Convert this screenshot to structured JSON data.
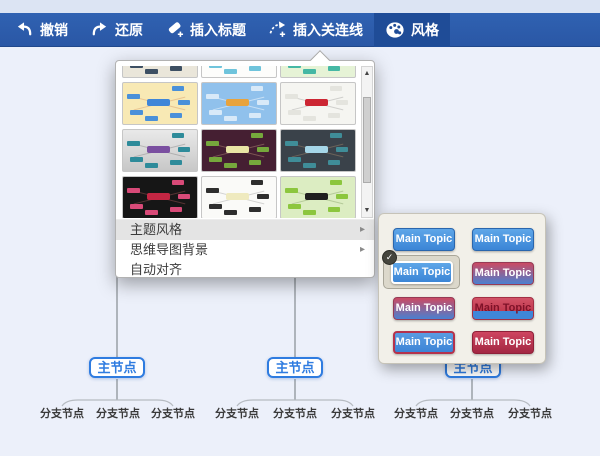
{
  "toolbar": {
    "items": [
      {
        "label": "撤销",
        "icon": "undo-icon",
        "active": false
      },
      {
        "label": "还原",
        "icon": "redo-icon",
        "active": false
      },
      {
        "label": "插入标题",
        "icon": "insert-title-icon",
        "active": false
      },
      {
        "label": "插入关连线",
        "icon": "insert-connector-icon",
        "active": false
      },
      {
        "label": "风格",
        "icon": "palette-icon",
        "active": true
      }
    ]
  },
  "style_panel": {
    "menu_items": [
      {
        "label": "主题风格",
        "has_submenu": true,
        "highlighted": true
      },
      {
        "label": "思维导图背景",
        "has_submenu": true,
        "highlighted": false
      },
      {
        "label": "自动对齐",
        "has_submenu": false,
        "highlighted": false
      }
    ],
    "submenu_caret": "▸",
    "scrollbar": {
      "up": "▲",
      "down": "▼"
    },
    "themes": [
      {
        "bg": "#eae6da",
        "center": "#3d4f63",
        "node": "#3d4f63",
        "line": "rgba(120,110,90,0.4)"
      },
      {
        "bg": "#fdfdfb",
        "center": "#4a90d9",
        "node": "#6fc4dc",
        "line": "rgba(150,150,150,0.35)"
      },
      {
        "bg": "#e6f3d6",
        "center": "#45b8a4",
        "node": "#45b8a4",
        "line": "rgba(120,150,100,0.4)"
      },
      {
        "bg": "#f8e9b4",
        "center": "#3f86d8",
        "node": "#4a90d9",
        "line": "rgba(215,150,100,0.45)"
      },
      {
        "bg": "#90c1ec",
        "center": "#e8a33d",
        "node": "#d8e9f8",
        "line": "rgba(255,255,255,0.5)"
      },
      {
        "bg": "#f5f5f1",
        "center": "#cc2633",
        "node": "#e4e4de",
        "line": "rgba(150,150,150,0.4)"
      },
      {
        "bg": "linear-gradient(#e9e9e9,#c7c7c7)",
        "center": "#7a4fa0",
        "node": "#2e8b9a",
        "line": "rgba(120,120,120,0.4)"
      },
      {
        "bg": "#451f32",
        "center": "#e9e5a5",
        "node": "#76a83c",
        "line": "rgba(230,190,150,0.35)"
      },
      {
        "bg": "#3a424a",
        "center": "#a5d6e8",
        "node": "#3f8d98",
        "line": "rgba(200,160,120,0.35)"
      },
      {
        "bg": "#161616",
        "center": "#c32643",
        "node": "#d84a78",
        "line": "rgba(240,120,120,0.3)"
      },
      {
        "bg": "#fafaf8",
        "center": "#efeabf",
        "node": "#2e2e2e",
        "line": "rgba(150,150,150,0.4)"
      },
      {
        "bg": "#dcedc2",
        "center": "#1f1f1f",
        "node": "#8cc63e",
        "line": "rgba(120,150,90,0.4)"
      }
    ]
  },
  "submenu": {
    "checkmark": "✓",
    "buttons": [
      {
        "label": "Main Topic",
        "style": "flat",
        "selected": false
      },
      {
        "label": "Main Topic",
        "style": "flat",
        "selected": false
      },
      {
        "label": "Main Topic",
        "style": "sel",
        "selected": true
      },
      {
        "label": "Main Topic",
        "style": "grad",
        "selected": false
      },
      {
        "label": "Main Topic",
        "style": "grad",
        "selected": false
      },
      {
        "label": "Main Topic",
        "style": "split",
        "selected": false
      },
      {
        "label": "Main Topic",
        "style": "rim",
        "selected": false
      },
      {
        "label": "Main Topic",
        "style": "crim",
        "selected": false
      }
    ]
  },
  "mindmap": {
    "nodes": [
      {
        "label": "主节点",
        "children": [
          "分支节点",
          "分支节点",
          "分支节点"
        ]
      },
      {
        "label": "主节点",
        "children": [
          "分支节点",
          "分支节点",
          "分支节点"
        ]
      },
      {
        "label": "主节点",
        "children": [
          "分支节点",
          "分支节点",
          "分支节点"
        ]
      }
    ]
  },
  "colors": {
    "toolbar_bg": "#2b5aa9",
    "toolbar_active_bg": "#1f4c97",
    "node_accent": "#2f7ce0",
    "connector": "#9aa0a6"
  }
}
